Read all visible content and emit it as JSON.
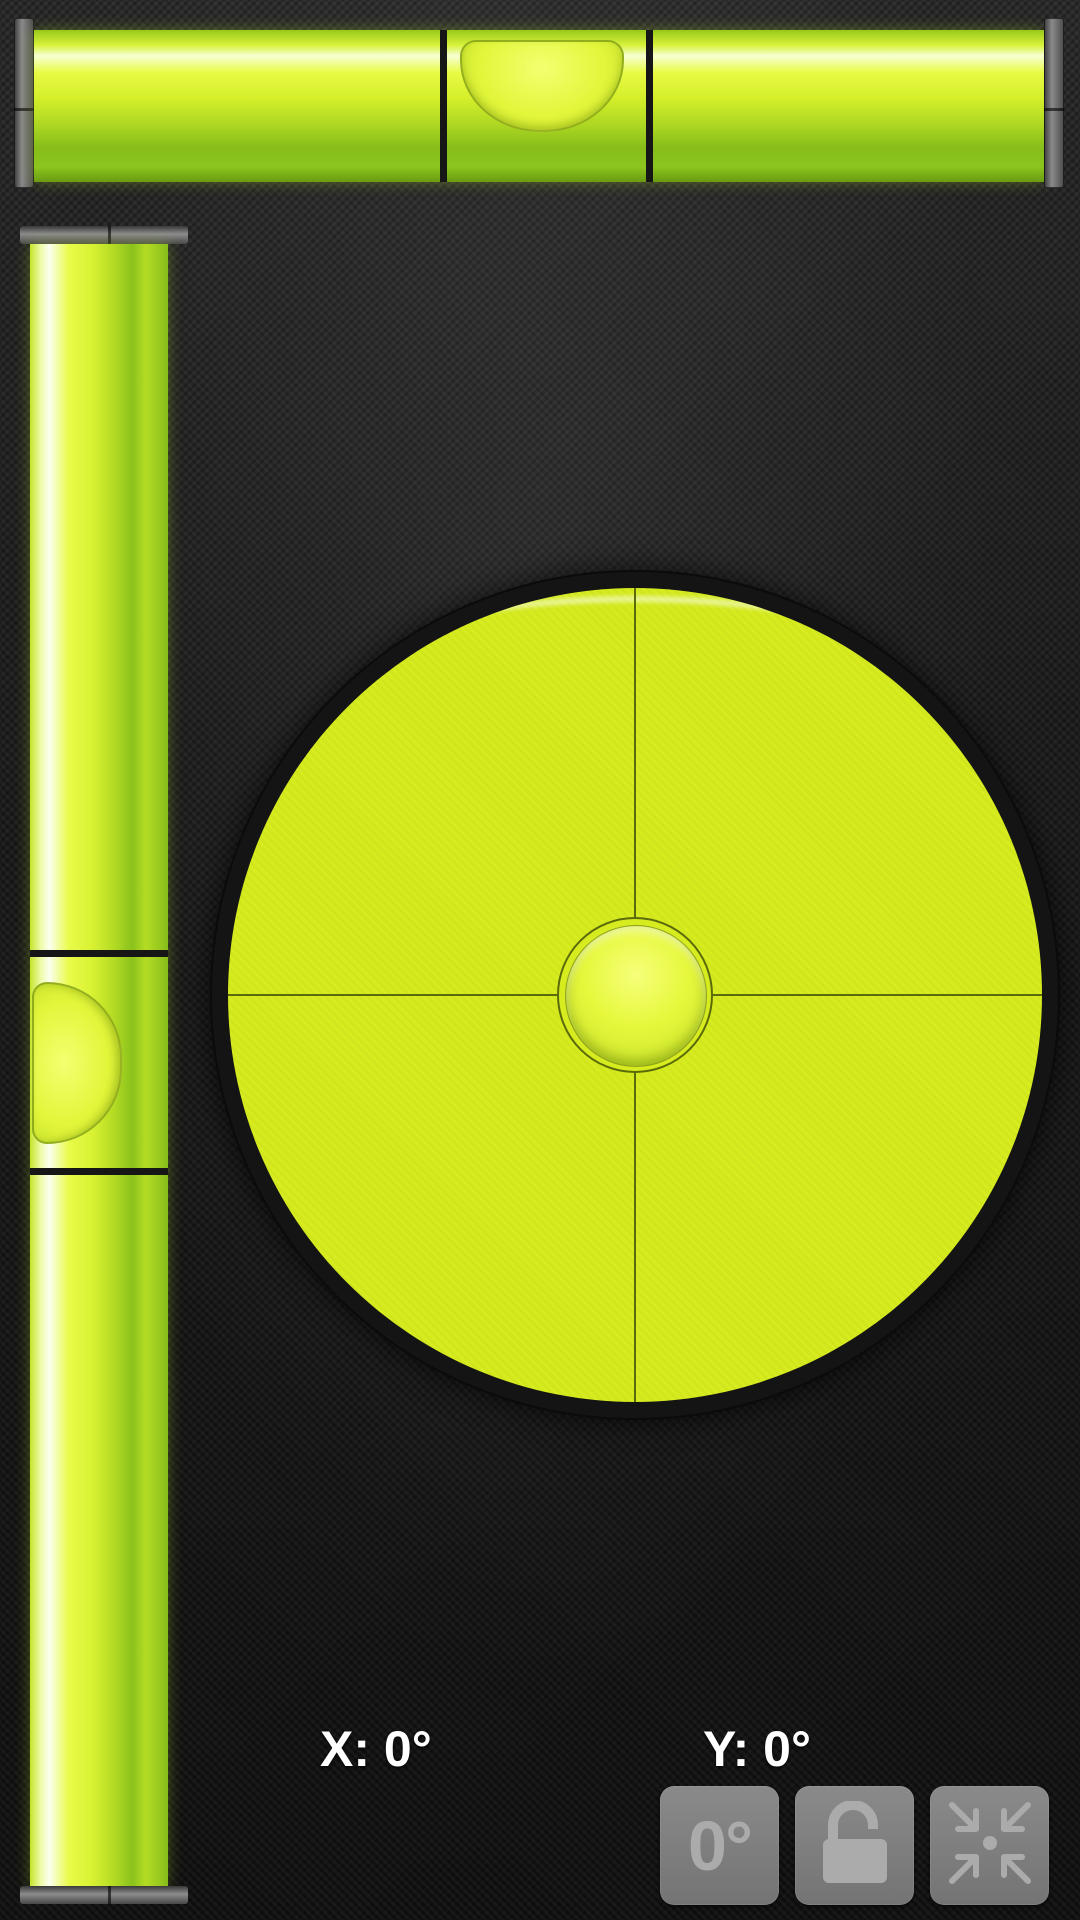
{
  "readouts": {
    "x_label": "X: 0°",
    "y_label": "Y: 0°"
  },
  "buttons": {
    "calibrate_label": "0°",
    "lock_icon": "lock-open-icon",
    "center_icon": "collapse-to-center-icon"
  },
  "colors": {
    "vial_green": "#d6ec1e",
    "background": "#1a1a1a",
    "button_gray": "#7f7f7f"
  }
}
